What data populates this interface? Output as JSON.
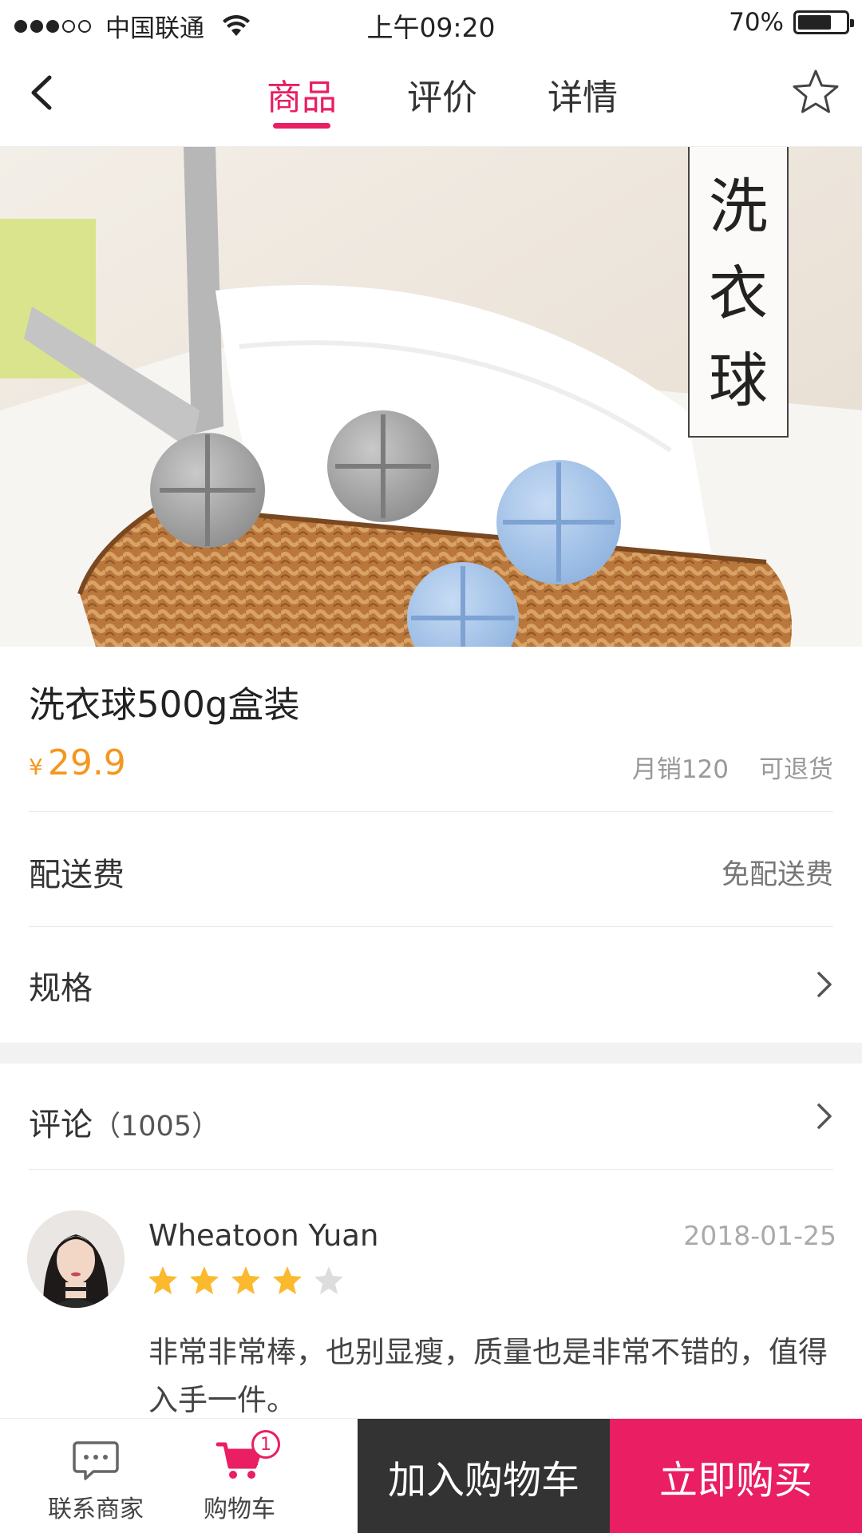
{
  "status_bar": {
    "carrier": "中国联通",
    "time": "上午09:20",
    "battery_text": "70%",
    "battery_level": 0.7
  },
  "header": {
    "tabs": [
      {
        "label": "商品",
        "active": true
      },
      {
        "label": "评价",
        "active": false
      },
      {
        "label": "详情",
        "active": false
      }
    ],
    "back_icon": "chevron-left-icon",
    "favorite_icon": "star-outline-icon"
  },
  "hero": {
    "badge_chars": [
      "洗",
      "衣",
      "球"
    ]
  },
  "product": {
    "name": "洗衣球500g盒装",
    "currency": "¥",
    "price": "29.9",
    "monthly_sales": "月销120",
    "return_policy": "可退货"
  },
  "delivery": {
    "label": "配送费",
    "value": "免配送费"
  },
  "spec": {
    "label": "规格"
  },
  "comments": {
    "label": "评论",
    "count": "（1005）"
  },
  "review": {
    "name": "Wheatoon Yuan",
    "date": "2018-01-25",
    "rating": 4,
    "max_rating": 5,
    "text": "非常非常棒，也别显瘦，质量也是非常不错的，值得入手一件。"
  },
  "bottom_bar": {
    "contact_label": "联系商家",
    "cart_label": "购物车",
    "cart_badge": "1",
    "add_to_cart": "加入购物车",
    "buy_now": "立即购买"
  },
  "colors": {
    "accent": "#e91e63",
    "price": "#f5961e",
    "star_filled": "#fbb92e",
    "star_empty": "#dddddd",
    "dark_button": "#333333"
  }
}
